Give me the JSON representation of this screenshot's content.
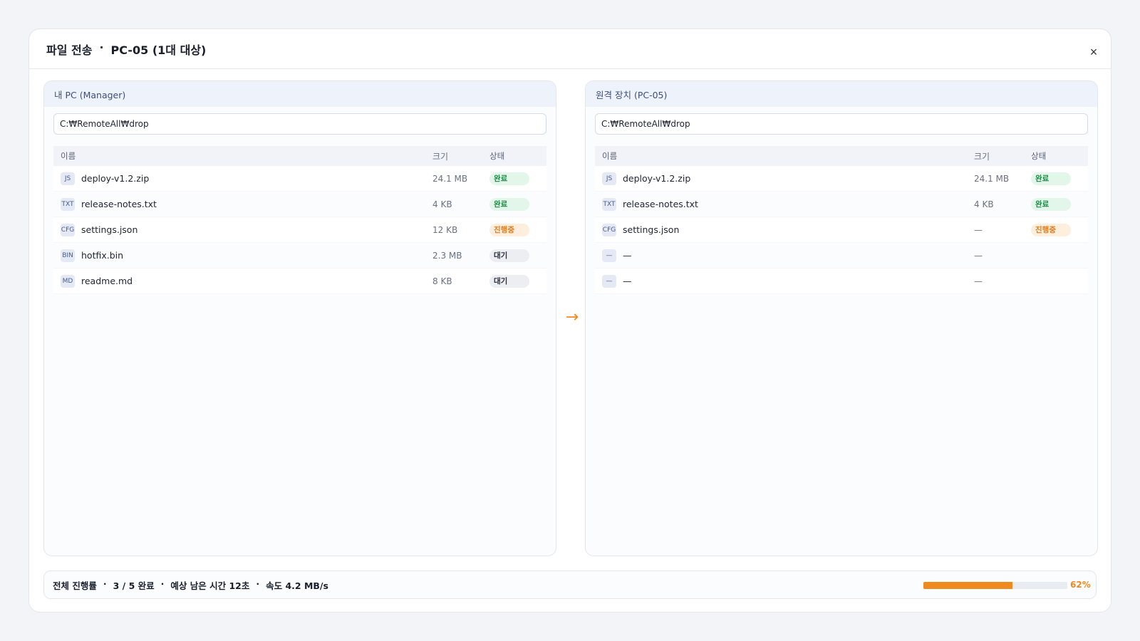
{
  "dialog": {
    "title_main": "파일 전송",
    "title_sep": "·",
    "title_target": "PC-05 (1대 대상)",
    "close_label": "×"
  },
  "columns": {
    "name": "이름",
    "size": "크기",
    "status": "상태"
  },
  "left_pane": {
    "title": "내 PC (Manager)",
    "path": "C:₩RemoteAll₩drop",
    "rows": [
      {
        "icon": "JS",
        "name": "deploy-v1.2.zip",
        "size": "24.1 MB",
        "status": "완료",
        "status_type": "done"
      },
      {
        "icon": "TXT",
        "name": "release-notes.txt",
        "size": "4 KB",
        "status": "완료",
        "status_type": "done"
      },
      {
        "icon": "CFG",
        "name": "settings.json",
        "size": "12 KB",
        "status": "진행중",
        "status_type": "prog"
      },
      {
        "icon": "BIN",
        "name": "hotfix.bin",
        "size": "2.3 MB",
        "status": "대기",
        "status_type": "wait"
      },
      {
        "icon": "MD",
        "name": "readme.md",
        "size": "8 KB",
        "status": "대기",
        "status_type": "wait"
      }
    ]
  },
  "right_pane": {
    "title": "원격 장치 (PC-05)",
    "path": "C:₩RemoteAll₩drop",
    "rows": [
      {
        "icon": "JS",
        "name": "deploy-v1.2.zip",
        "size": "24.1 MB",
        "status": "완료",
        "status_type": "done"
      },
      {
        "icon": "TXT",
        "name": "release-notes.txt",
        "size": "4 KB",
        "status": "완료",
        "status_type": "done"
      },
      {
        "icon": "CFG",
        "name": "settings.json",
        "size": "—",
        "status": "진행중",
        "status_type": "prog"
      },
      {
        "icon": "—",
        "name": "—",
        "size": "—",
        "status": "",
        "status_type": "none"
      },
      {
        "icon": "—",
        "name": "—",
        "size": "—",
        "status": "",
        "status_type": "none"
      }
    ]
  },
  "transfer_arrow": "→",
  "footer": {
    "label": "전체 진행률",
    "sep": "·",
    "completed": "3 / 5 완료",
    "eta": "예상 남은 시간 12초",
    "speed": "속도 4.2 MB/s",
    "progress_percent": 62,
    "progress_text": "62%"
  },
  "colors": {
    "accent": "#ef8a1f",
    "done": "#1f8a46",
    "in_progress": "#e07c1c"
  }
}
